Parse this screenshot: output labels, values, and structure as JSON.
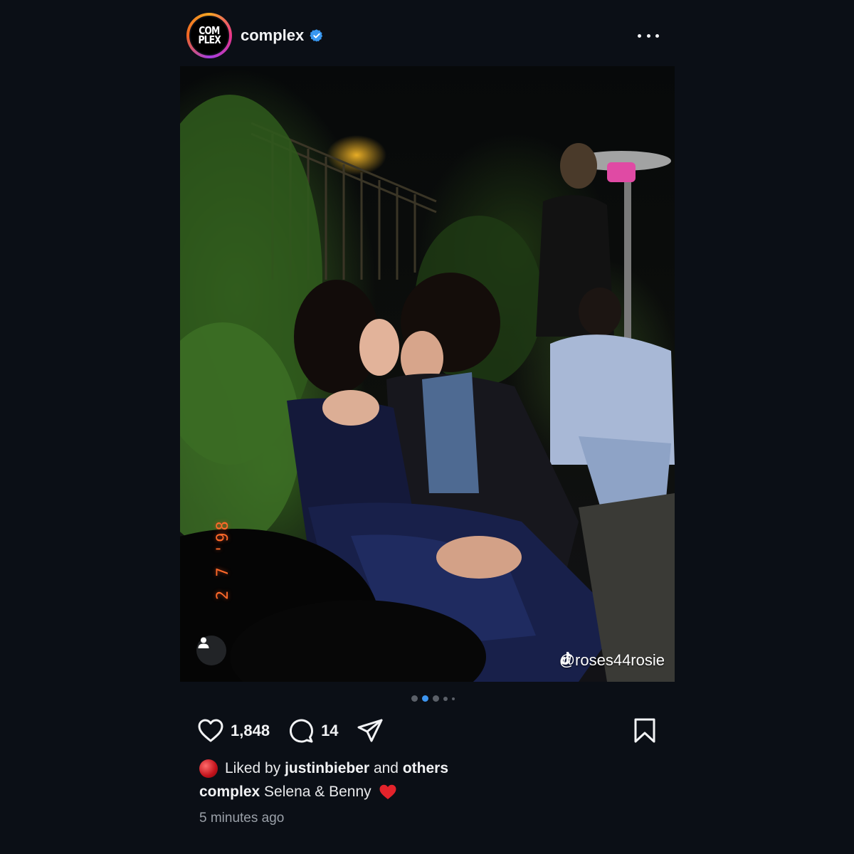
{
  "header": {
    "avatar_line1": "COM",
    "avatar_line2": "PLEX",
    "username": "complex",
    "verified_icon": "verified-badge-icon",
    "more_icon": "more-options-icon"
  },
  "photo": {
    "date_stamp": "2 7 '98",
    "watermark_text": "@roses44rosie",
    "watermark_icon": "tiktok-icon",
    "tag_icon": "user-tag-icon"
  },
  "carousel": {
    "total_dots": 5,
    "active_index": 1
  },
  "actions": {
    "like_count": "1,848",
    "comment_count": "14",
    "like_icon": "heart-icon",
    "comment_icon": "comment-bubble-icon",
    "share_icon": "send-icon",
    "save_icon": "bookmark-icon"
  },
  "caption": {
    "liked_by_prefix": "Liked by",
    "liked_by_user": "justinbieber",
    "liked_by_and": "and",
    "liked_by_others": "others",
    "author": "complex",
    "text": "Selena & Benny",
    "emoji": "red-heart-emoji",
    "timestamp": "5 minutes ago"
  },
  "colors": {
    "background": "#0b0f16",
    "active_dot": "#3d95f0",
    "verified_blue": "#3897f0",
    "date_stamp": "#ff6a2a"
  }
}
